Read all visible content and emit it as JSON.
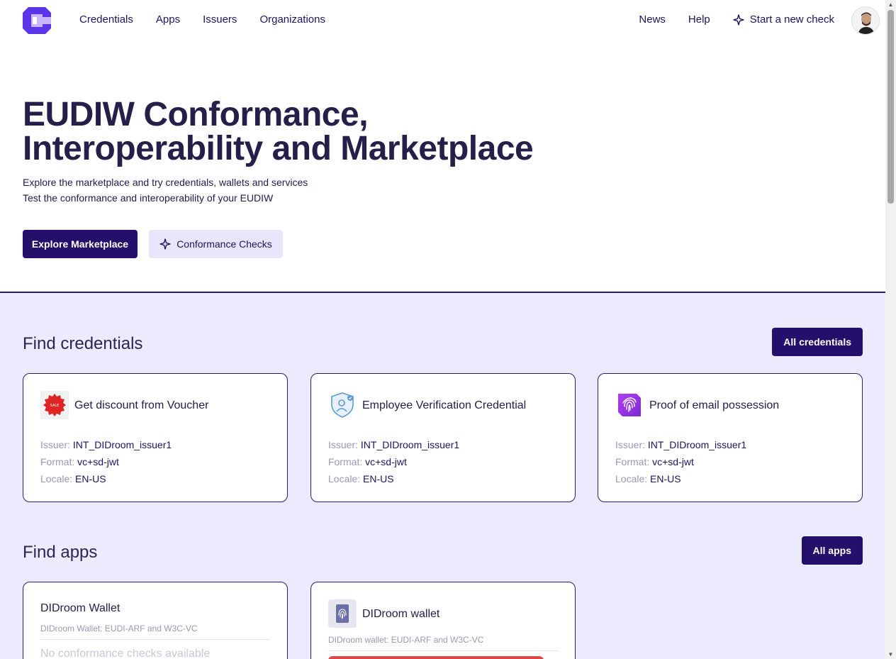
{
  "nav": {
    "items": [
      "Credentials",
      "Apps",
      "Issuers",
      "Organizations"
    ],
    "right": {
      "news": "News",
      "help": "Help",
      "start_check": "Start a new check"
    }
  },
  "hero": {
    "title_line1": "EUDIW Conformance,",
    "title_line2": "Interoperability and Marketplace",
    "sub_line1": "Explore the marketplace and try credentials, wallets and services",
    "sub_line2": "Test the conformance and interoperability of your EUDIW",
    "explore_label": "Explore Marketplace",
    "conformance_label": "Conformance Checks"
  },
  "credentials": {
    "title": "Find credentials",
    "all_label": "All credentials",
    "labels": {
      "issuer": "Issuer:",
      "format": "Format:",
      "locale": "Locale:"
    },
    "items": [
      {
        "name": "Get discount from Voucher",
        "issuer": "INT_DIDroom_issuer1",
        "format": "vc+sd-jwt",
        "locale": "EN-US",
        "icon": "voucher-icon"
      },
      {
        "name": "Employee Verification Credential",
        "issuer": "INT_DIDroom_issuer1",
        "format": "vc+sd-jwt",
        "locale": "EN-US",
        "icon": "shield-user-icon"
      },
      {
        "name": "Proof of email possession",
        "issuer": "INT_DIDroom_issuer1",
        "format": "vc+sd-jwt",
        "locale": "EN-US",
        "icon": "fingerprint-icon"
      }
    ]
  },
  "apps": {
    "title": "Find apps",
    "all_label": "All apps",
    "items": [
      {
        "name": "DIDroom Wallet",
        "desc": "DIDroom Wallet: EUDI-ARF and W3C-VC",
        "status": "No conformance checks available"
      },
      {
        "name": "DIDroom wallet",
        "desc": "DIDroom wallet: EUDI-ARF and W3C-VC"
      }
    ]
  },
  "colors": {
    "primary": "#24106a",
    "soft": "#e9e6fb",
    "section_bg": "#ecebfd",
    "accent_purple": "#6a3df0"
  }
}
